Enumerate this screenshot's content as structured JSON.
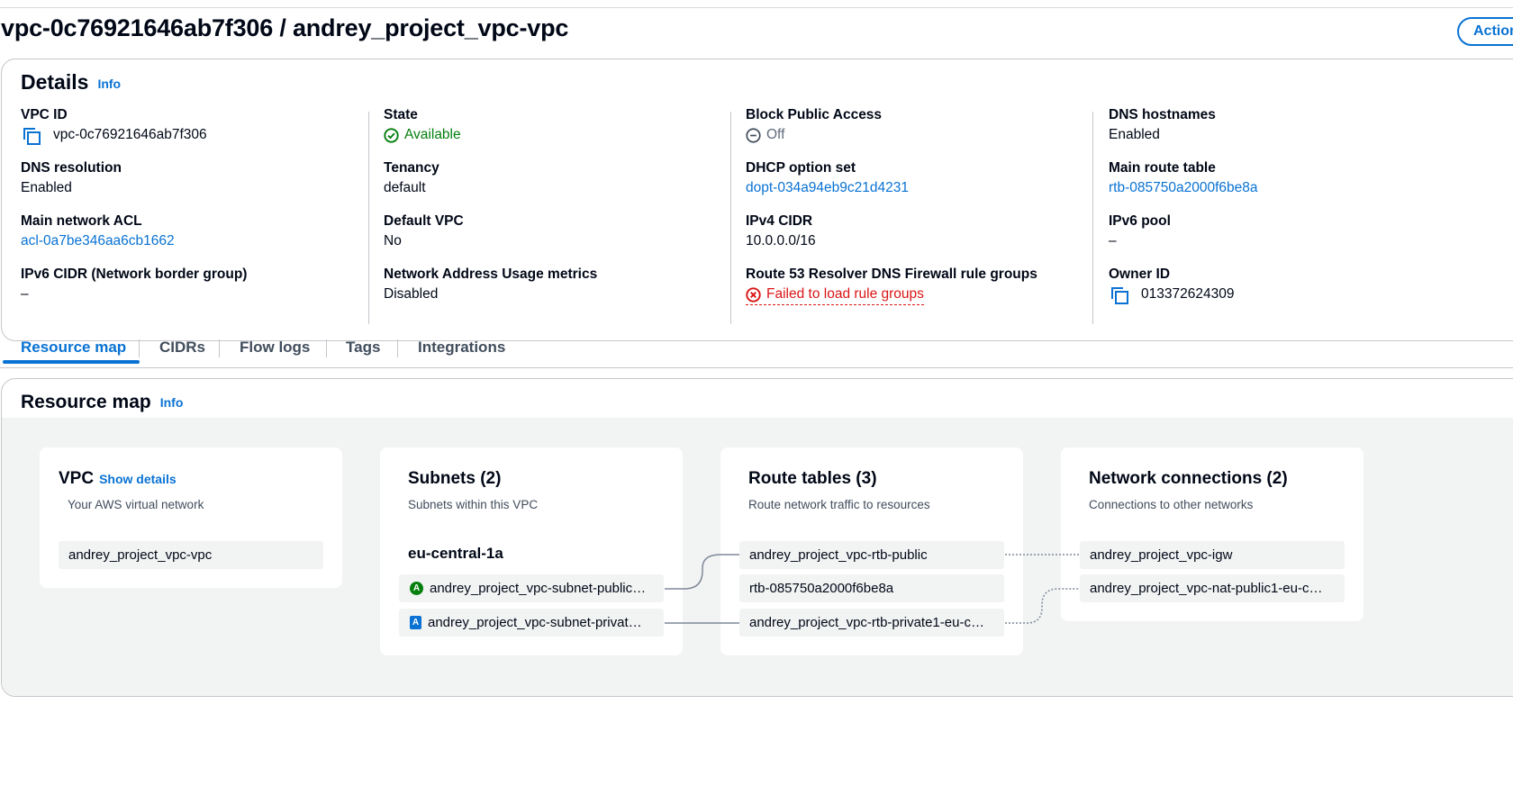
{
  "header": {
    "title": "vpc-0c76921646ab7f306 / andrey_project_vpc-vpc",
    "actions_label": "Actions"
  },
  "details": {
    "heading": "Details",
    "info": "Info",
    "columns": [
      [
        {
          "label": "VPC ID",
          "value": "vpc-0c76921646ab7f306",
          "kind": "copy"
        },
        {
          "label": "DNS resolution",
          "value": "Enabled",
          "kind": "text"
        },
        {
          "label": "Main network ACL",
          "value": "acl-0a7be346aa6cb1662",
          "kind": "link"
        },
        {
          "label": "IPv6 CIDR (Network border group)",
          "value": "–",
          "kind": "text"
        }
      ],
      [
        {
          "label": "State",
          "value": "Available",
          "kind": "status-ok"
        },
        {
          "label": "Tenancy",
          "value": "default",
          "kind": "text"
        },
        {
          "label": "Default VPC",
          "value": "No",
          "kind": "text"
        },
        {
          "label": "Network Address Usage metrics",
          "value": "Disabled",
          "kind": "text"
        }
      ],
      [
        {
          "label": "Block Public Access",
          "value": "Off",
          "kind": "status-off"
        },
        {
          "label": "DHCP option set",
          "value": "dopt-034a94eb9c21d4231",
          "kind": "link"
        },
        {
          "label": "IPv4 CIDR",
          "value": "10.0.0.0/16",
          "kind": "text"
        },
        {
          "label": "Route 53 Resolver DNS Firewall rule groups",
          "value": "Failed to load rule groups",
          "kind": "status-error"
        }
      ],
      [
        {
          "label": "DNS hostnames",
          "value": "Enabled",
          "kind": "text"
        },
        {
          "label": "Main route table",
          "value": "rtb-085750a2000f6be8a",
          "kind": "link"
        },
        {
          "label": "IPv6 pool",
          "value": "–",
          "kind": "text"
        },
        {
          "label": "Owner ID",
          "value": "013372624309",
          "kind": "copy"
        }
      ]
    ]
  },
  "tabs": [
    "Resource map",
    "CIDRs",
    "Flow logs",
    "Tags",
    "Integrations"
  ],
  "resource_map": {
    "heading": "Resource map",
    "info": "Info",
    "vpc_card": {
      "title": "VPC",
      "show_details": "Show details",
      "subtitle": "Your AWS virtual network",
      "items": [
        "andrey_project_vpc-vpc"
      ]
    },
    "subnets_card": {
      "title": "Subnets (2)",
      "subtitle": "Subnets within this VPC",
      "az": "eu-central-1a",
      "items": [
        {
          "badge": "A",
          "label": "andrey_project_vpc-subnet-public…"
        },
        {
          "badge": "A",
          "label": "andrey_project_vpc-subnet-privat…"
        }
      ]
    },
    "route_tables_card": {
      "title": "Route tables (3)",
      "subtitle": "Route network traffic to resources",
      "items": [
        "andrey_project_vpc-rtb-public",
        "rtb-085750a2000f6be8a",
        "andrey_project_vpc-rtb-private1-eu-c…"
      ]
    },
    "network_card": {
      "title": "Network connections (2)",
      "subtitle": "Connections to other networks",
      "items": [
        "andrey_project_vpc-igw",
        "andrey_project_vpc-nat-public1-eu-c…"
      ]
    }
  },
  "colors": {
    "accent": "#0972d3",
    "success": "#037f0c",
    "error": "#d91515",
    "muted": "#5f6b7a"
  }
}
